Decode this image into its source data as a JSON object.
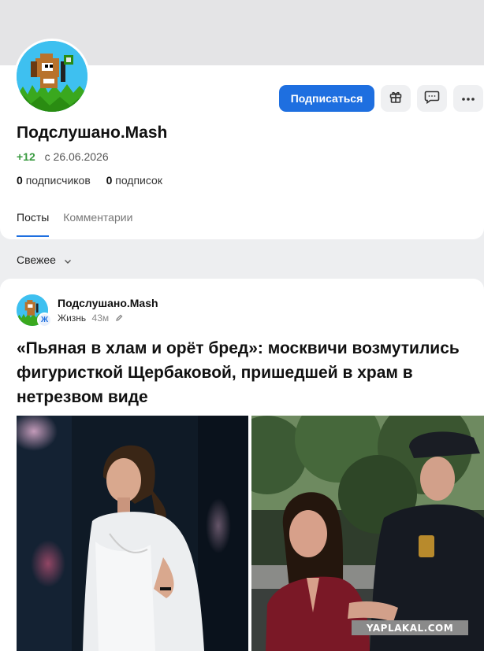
{
  "profile": {
    "name": "Подслушано.Mash",
    "karma": "+12",
    "since": "с 26.06.2026",
    "followers_count": "0",
    "followers_label": "подписчиков",
    "following_count": "0",
    "following_label": "подписок",
    "avatar_icon": "duck-hunt-dog-avatar"
  },
  "actions": {
    "subscribe_label": "Подписаться",
    "gift_icon": "gift-icon",
    "message_icon": "message-icon",
    "more_icon": "more-icon"
  },
  "tabs": [
    {
      "label": "Посты",
      "active": true
    },
    {
      "label": "Комментарии",
      "active": false
    }
  ],
  "sort": {
    "label": "Свежее",
    "icon": "chevron-down-icon"
  },
  "post": {
    "author": "Подслушано.Mash",
    "category_badge": "Ж",
    "category": "Жизнь",
    "time": "43м",
    "title": "«Пьяная в хлам и орёт бред»: москвичи возмутились фигуристкой Щербаковой, пришедшей в храм в нетрезвом виде"
  },
  "watermark": "YAPLAKAL.COM",
  "colors": {
    "accent": "#1e6fe0",
    "karma": "#3a9b41",
    "page_bg": "#edeef0"
  }
}
